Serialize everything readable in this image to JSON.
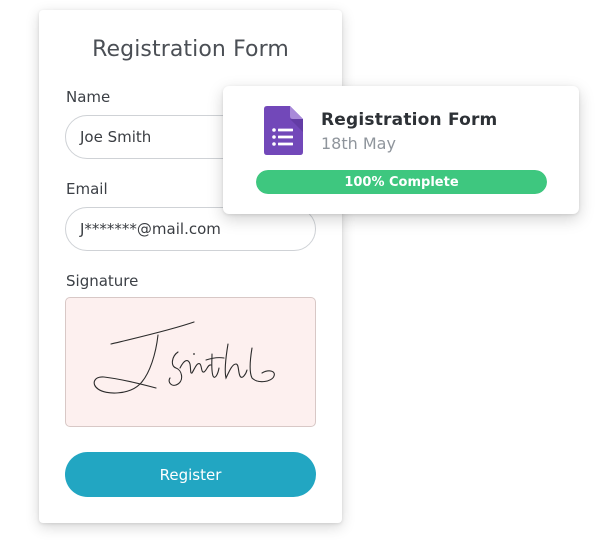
{
  "form": {
    "title": "Registration Form",
    "name_label": "Name",
    "name_value": "Joe Smith",
    "email_label": "Email",
    "email_value": "J*******@mail.com",
    "signature_label": "Signature",
    "register_label": "Register"
  },
  "status_card": {
    "icon": "form-document-icon",
    "title": "Registration Form",
    "date": "18th May",
    "progress_text": "100% Complete",
    "progress_fraction": 1.0
  },
  "colors": {
    "accent_button": "#22a6c2",
    "progress_fill": "#3ec77f",
    "icon_purple": "#7248b9",
    "signature_bg": "#fdf0ef"
  }
}
